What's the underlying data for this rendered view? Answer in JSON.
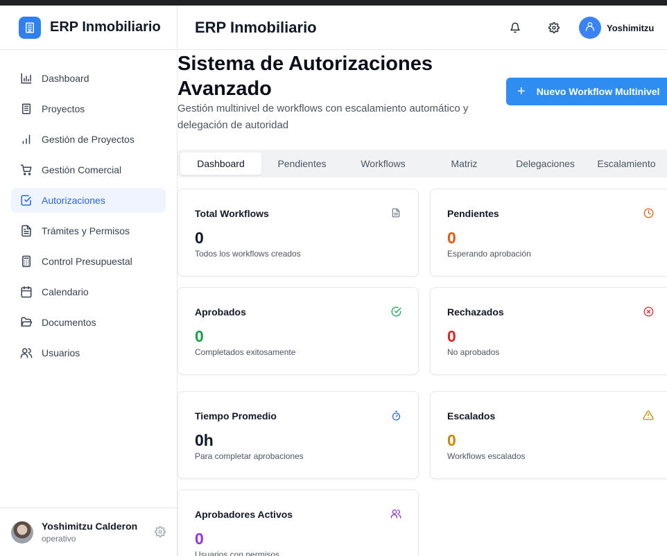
{
  "app": {
    "brand": "ERP Inmobiliario",
    "header_title": "ERP Inmobiliario",
    "header_user": "Yoshimitzu"
  },
  "sidebar": {
    "items": [
      {
        "label": "Dashboard",
        "icon": "bar-chart-icon"
      },
      {
        "label": "Proyectos",
        "icon": "building-icon"
      },
      {
        "label": "Gestión de Proyectos",
        "icon": "signal-bars-icon"
      },
      {
        "label": "Gestión Comercial",
        "icon": "shopping-cart-icon"
      },
      {
        "label": "Autorizaciones",
        "icon": "check-square-icon",
        "active": true
      },
      {
        "label": "Trámites y Permisos",
        "icon": "file-text-icon"
      },
      {
        "label": "Control Presupuestal",
        "icon": "calculator-icon"
      },
      {
        "label": "Calendario",
        "icon": "calendar-icon"
      },
      {
        "label": "Documentos",
        "icon": "folder-open-icon"
      },
      {
        "label": "Usuarios",
        "icon": "users-icon"
      }
    ],
    "footer": {
      "name": "Yoshimitzu Calderon",
      "role": "operativo"
    }
  },
  "page": {
    "title": "Sistema de Autorizaciones Avanzado",
    "subtitle": "Gestión multinivel de workflows con escalamiento automático y delegación de autoridad",
    "new_button": "Nuevo Workflow Multinivel"
  },
  "tabs": [
    "Dashboard",
    "Pendientes",
    "Workflows",
    "Matriz",
    "Delegaciones",
    "Escalamiento"
  ],
  "cards": [
    {
      "title": "Total Workflows",
      "value": "0",
      "desc": "Todos los workflows creados",
      "color": "#111827",
      "icon": "file-text-icon"
    },
    {
      "title": "Pendientes",
      "value": "0",
      "desc": "Esperando aprobación",
      "color": "#ea580c",
      "icon": "clock-icon"
    },
    {
      "title": "Aprobados",
      "value": "0",
      "desc": "Completados exitosamente",
      "color": "#16a34a",
      "icon": "check-circle-icon"
    },
    {
      "title": "Rechazados",
      "value": "0",
      "desc": "No aprobados",
      "color": "#dc2626",
      "icon": "x-circle-icon"
    },
    {
      "title": "Tiempo Promedio",
      "value": "0h",
      "desc": "Para completar aprobaciones",
      "color": "#111827",
      "icon": "timer-icon"
    },
    {
      "title": "Escalados",
      "value": "0",
      "desc": "Workflows escalados",
      "color": "#ca8a04",
      "icon": "alert-triangle-icon"
    },
    {
      "title": "Aprobadores Activos",
      "value": "0",
      "desc": "Usuarios con permisos",
      "color": "#9333ea",
      "icon": "users-icon"
    }
  ]
}
